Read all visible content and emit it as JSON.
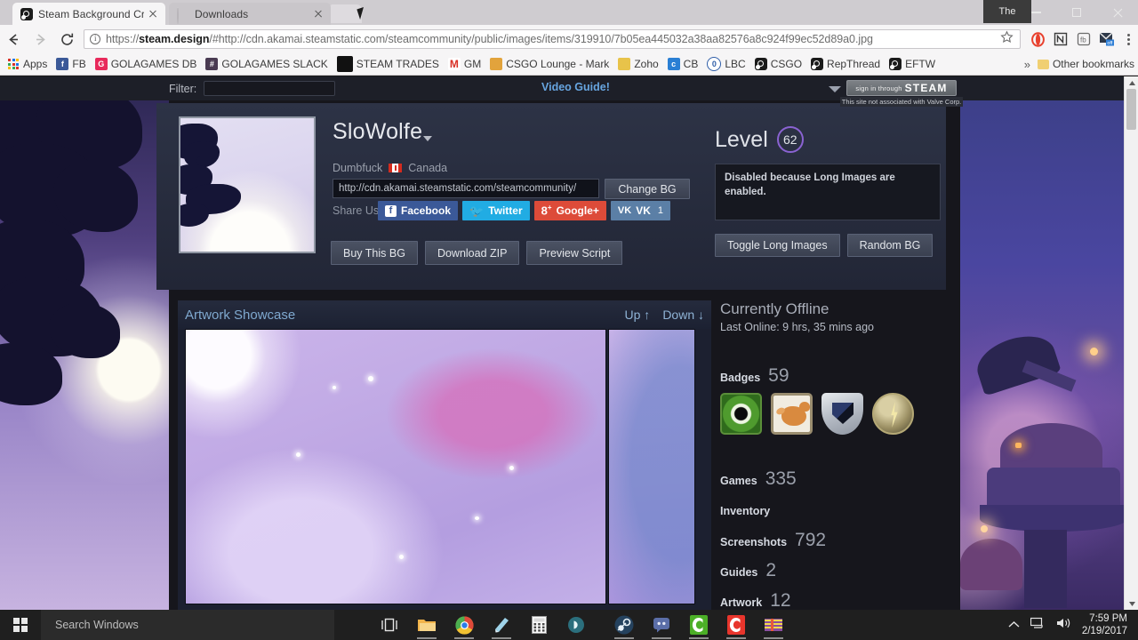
{
  "browser": {
    "tabs": [
      {
        "title": "Steam Background Crop",
        "favicon": "steam-icon",
        "active": true
      },
      {
        "title": "Downloads",
        "favicon": "loading-spinner-icon",
        "active": false
      }
    ],
    "window_badge": "The",
    "nav": {
      "back": "back-arrow-icon",
      "forward": "forward-arrow-icon",
      "reload": "reload-icon"
    },
    "address": {
      "security": "info-icon",
      "prefix": "https://",
      "domain": "steam.design",
      "rest": "/#http://cdn.akamai.steamstatic.com/steamcommunity/public/images/items/319910/7b05ea445032a38aa82576a8c924f99ec52d89a0.jpg",
      "full": "https://steam.design/#http://cdn.akamai.steamstatic.com/steamcommunity/public/images/items/319910/7b05ea445032a38aa82576a8c924f99ec52d89a0.jpg",
      "bookmark_star": "star-icon"
    },
    "extensions": [
      "opera-icon",
      "notebook-icon",
      "fb-icon",
      "mail-off-icon"
    ],
    "menu": "three-dot-menu-icon",
    "bookmarks": [
      {
        "label": "Apps",
        "icon": "apps-grid-icon"
      },
      {
        "label": "FB",
        "icon": "facebook-icon",
        "color": "#3b5998"
      },
      {
        "label": "GOLAGAMES DB",
        "icon": "g-icon",
        "color": "#e8295b"
      },
      {
        "label": "GOLAGAMES SLACK",
        "icon": "slack-icon",
        "color": "#4a3b52"
      },
      {
        "label": "STEAM TRADES",
        "icon": "square-icon",
        "color": "#111111"
      },
      {
        "label": "GM",
        "icon": "gmail-icon",
        "color": "#d93025"
      },
      {
        "label": "CSGO Lounge - Mark",
        "icon": "lounge-icon",
        "color": "#e2a33c"
      },
      {
        "label": "Zoho",
        "icon": "zoho-icon",
        "color": "#e8c34a"
      },
      {
        "label": "CB",
        "icon": "cb-icon",
        "color": "#2a7fd4"
      },
      {
        "label": "LBC",
        "icon": "lbc-icon",
        "color": "#2f5ea8"
      },
      {
        "label": "CSGO",
        "icon": "steam-icon",
        "color": "#1b1b1b"
      },
      {
        "label": "RepThread",
        "icon": "steam-icon",
        "color": "#1b1b1b"
      },
      {
        "label": "EFTW",
        "icon": "steam-icon",
        "color": "#1b1b1b"
      }
    ],
    "bookmarks_overflow": "»",
    "other_bookmarks": "Other bookmarks"
  },
  "page": {
    "topbar": {
      "filter_label": "Filter:",
      "filter_value": "",
      "video_guide": "Video Guide!",
      "dropdown_icon": "chevron-down-icon",
      "signin_small": "sign in through",
      "signin_brand": "STEAM",
      "signin_note": "This site not associated with Valve Corp."
    },
    "profile": {
      "avatar_alt": "moon-and-trees-avatar",
      "name": "SloWolfe",
      "name_caret": "chevron-down-icon",
      "nickname": "Dumbfuck",
      "flag": "canada-flag-icon",
      "country": "Canada",
      "bg_url": "http://cdn.akamai.steamstatic.com/steamcommunity/",
      "change_bg": "Change BG",
      "share_label": "Share Us:",
      "share": [
        {
          "label": "Facebook",
          "icon": "facebook-icon",
          "color": "#3b5998",
          "count": ""
        },
        {
          "label": "Twitter",
          "icon": "twitter-icon",
          "color": "#21ace3",
          "count": ""
        },
        {
          "label": "Google+",
          "icon": "googleplus-icon",
          "color": "#dd4b39",
          "count": ""
        },
        {
          "label": "VK",
          "icon": "vk-icon",
          "color": "#5b7fa6",
          "count": "1"
        }
      ],
      "actions": [
        "Buy This BG",
        "Download ZIP",
        "Preview Script"
      ],
      "level_label": "Level",
      "level_value": "62",
      "level_ring_color": "#8a63d2",
      "notice": "Disabled because Long Images are enabled.",
      "low_actions": [
        "Toggle Long Images",
        "Random BG"
      ]
    },
    "showcase": {
      "title": "Artwork Showcase",
      "up": "Up ↑",
      "down": "Down ↓",
      "main_art_alt": "purple-nebula-artwork",
      "side_art_alt": "purple-artwork-thumb"
    },
    "stats": {
      "status": "Currently Offline",
      "last_online": "Last Online: 9 hrs, 35 mins ago",
      "badges_label": "Badges",
      "badges_count": "59",
      "badge_icons": [
        "green-eye-badge-icon",
        "dog-artwork-badge-icon",
        "silver-shield-badge-icon",
        "gold-lightning-badge-icon"
      ],
      "rows": [
        {
          "key": "Games",
          "value": "335"
        },
        {
          "key": "Inventory",
          "value": ""
        },
        {
          "key": "Screenshots",
          "value": "792"
        },
        {
          "key": "Guides",
          "value": "2"
        },
        {
          "key": "Artwork",
          "value": "12"
        }
      ]
    }
  },
  "taskbar": {
    "start": "windows-start-icon",
    "search_placeholder": "Search Windows",
    "apps": [
      {
        "name": "task-view-icon"
      },
      {
        "name": "file-explorer-icon"
      },
      {
        "name": "chrome-icon"
      },
      {
        "name": "notepad-icon"
      },
      {
        "name": "calculator-icon"
      },
      {
        "name": "media-player-icon"
      },
      {
        "name": "steam-icon"
      },
      {
        "name": "discord-icon"
      },
      {
        "name": "green-c-icon"
      },
      {
        "name": "red-c-icon"
      },
      {
        "name": "winrar-icon"
      }
    ],
    "tray": [
      "chevron-up-icon",
      "network-icon",
      "volume-icon"
    ],
    "time": "7:59 PM",
    "date": "2/19/2017"
  }
}
